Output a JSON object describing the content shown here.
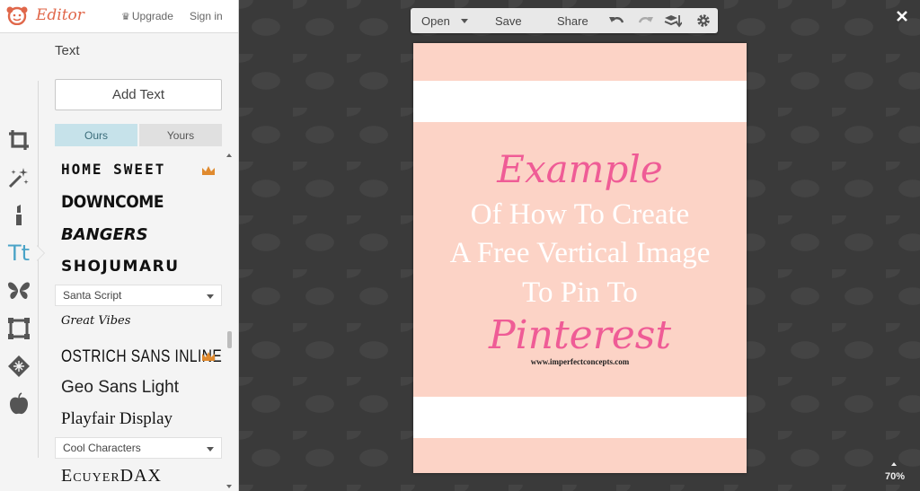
{
  "app": {
    "title": "Editor",
    "upgrade": "Upgrade",
    "signin": "Sign in"
  },
  "panel": {
    "title": "Text",
    "add_text": "Add Text",
    "tabs": [
      {
        "label": "Ours",
        "active": true
      },
      {
        "label": "Yours",
        "active": false
      }
    ],
    "fonts": [
      {
        "label": "HOME SWEET",
        "premium": true
      },
      {
        "label": "DOWNCOME",
        "premium": false
      },
      {
        "label": "BANGERS",
        "premium": false
      },
      {
        "label": "SHOJUMARU",
        "premium": false
      },
      {
        "label": "Santa Script",
        "kind": "category"
      },
      {
        "label": "Great Vibes",
        "premium": false
      },
      {
        "label": "OSTRICH SANS INLINE",
        "premium": true
      },
      {
        "label": "Geo Sans Light",
        "premium": false
      },
      {
        "label": "Playfair Display",
        "premium": false
      },
      {
        "label": "Cool Characters",
        "kind": "category"
      },
      {
        "label": "EcuyerDAX",
        "premium": false
      }
    ]
  },
  "tools": [
    {
      "name": "crop-icon",
      "active": false
    },
    {
      "name": "magic-wand-icon",
      "active": false
    },
    {
      "name": "lipstick-icon",
      "active": false
    },
    {
      "name": "text-icon",
      "label": "Tt",
      "active": true
    },
    {
      "name": "butterfly-icon",
      "active": false
    },
    {
      "name": "frame-icon",
      "active": false
    },
    {
      "name": "texture-icon",
      "active": false
    },
    {
      "name": "apple-icon",
      "active": false
    }
  ],
  "toolbar": {
    "open": "Open",
    "save": "Save",
    "share": "Share"
  },
  "poster": {
    "line1": "Example",
    "line2": "Of How To Create",
    "line3": "A Free Vertical Image",
    "line4": "To Pin To",
    "line5": "Pinterest",
    "url": "www.imperfectconcepts.com"
  },
  "zoom": "70%",
  "colors": {
    "accent": "#4aa3c7",
    "brand": "#e0674a",
    "poster_bg": "#fcd3c6",
    "poster_script": "#ef5c96",
    "crown": "#e08a2e"
  }
}
